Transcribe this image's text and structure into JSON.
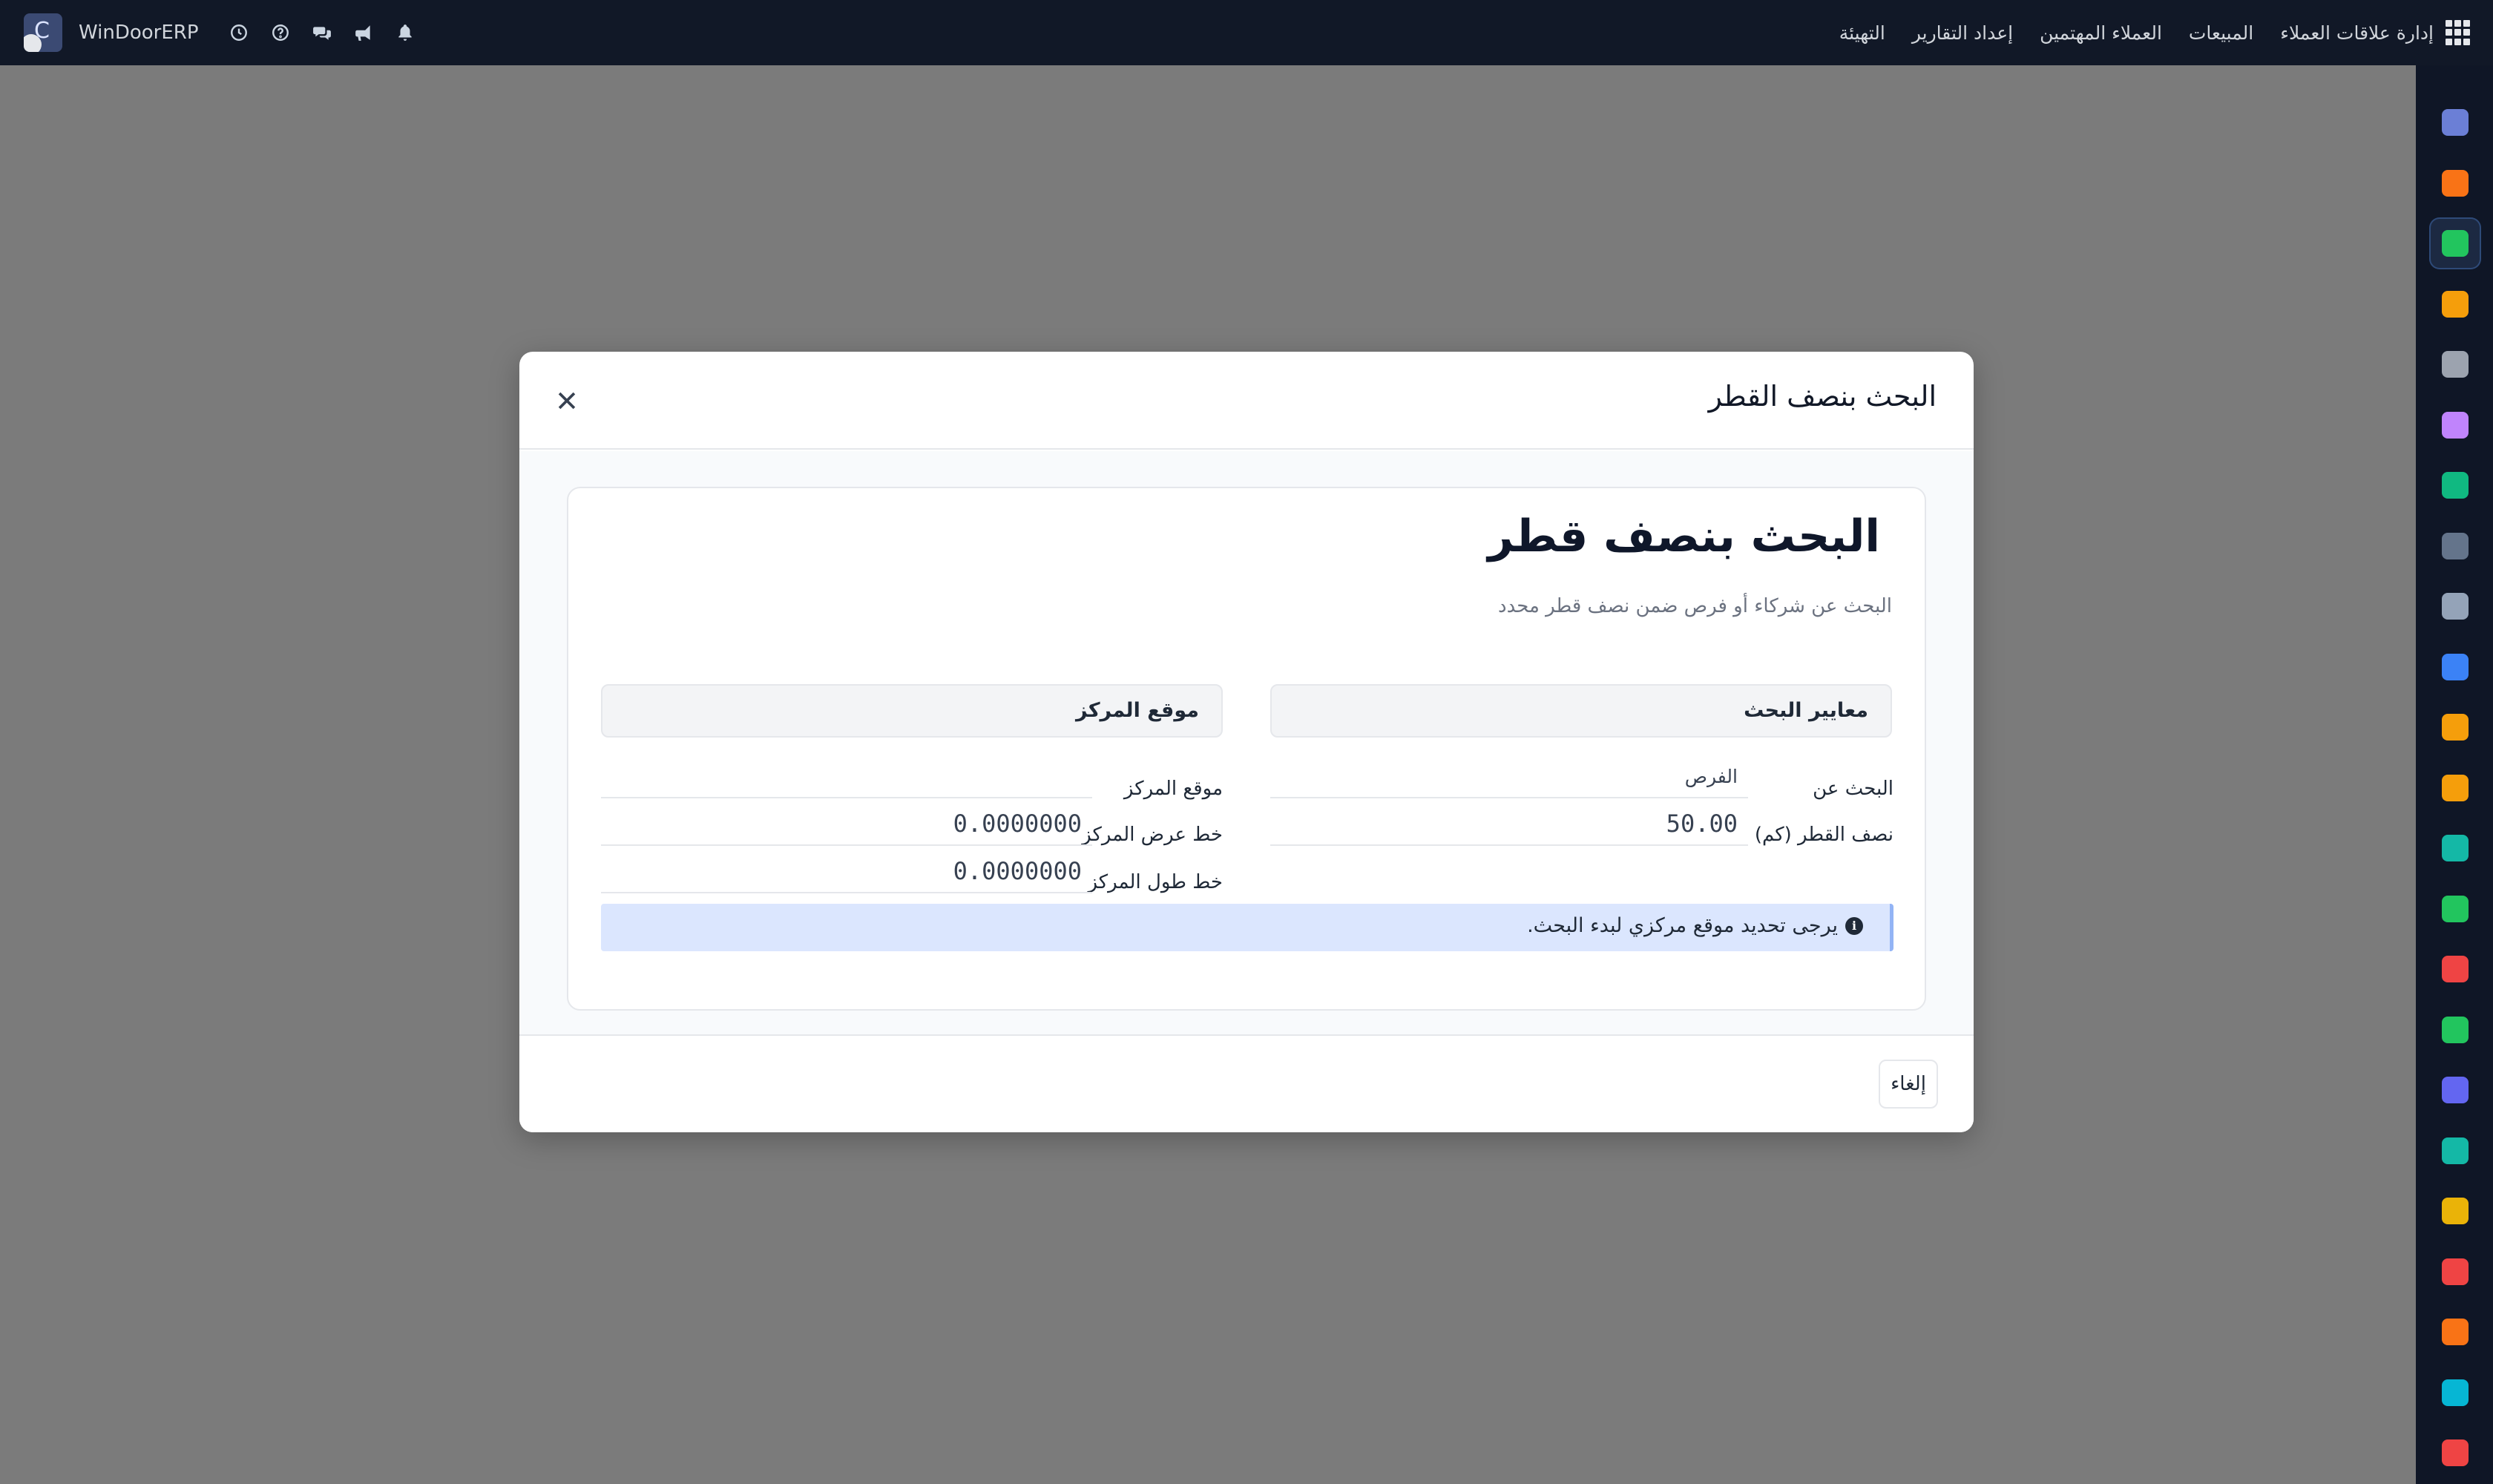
{
  "navbar": {
    "brand_name": "WinDoorERP",
    "menu": [
      "إدارة علاقات العملاء",
      "المبيعات",
      "العملاء المهتمين",
      "إعداد التقارير",
      "التهيئة"
    ],
    "icons": [
      "clock-icon",
      "help-icon",
      "chat-icon",
      "megaphone-icon",
      "bell-icon",
      "apps-grid-icon"
    ]
  },
  "appbar": {
    "items": [
      {
        "icon": "mail-app-icon",
        "color": "#6b7fd6"
      },
      {
        "icon": "discuss-app-icon",
        "color": "#f97316"
      },
      {
        "icon": "crm-app-icon",
        "color": "#22c55e"
      },
      {
        "icon": "sales-app-icon",
        "color": "#f59e0b"
      },
      {
        "icon": "product-app-icon",
        "color": "#9ca3af"
      },
      {
        "icon": "contacts-app-icon",
        "color": "#c084fc"
      },
      {
        "icon": "tasks-app-icon",
        "color": "#10b981"
      },
      {
        "icon": "helpdesk-app-icon",
        "color": "#64748b"
      },
      {
        "icon": "inventory-app-icon",
        "color": "#94a3b8"
      },
      {
        "icon": "documents-app-icon",
        "color": "#3b82f6"
      },
      {
        "icon": "employees-app-icon",
        "color": "#f59e0b"
      },
      {
        "icon": "calendar-app-icon",
        "color": "#f59e0b"
      },
      {
        "icon": "sign-app-icon",
        "color": "#14b8a6"
      },
      {
        "icon": "hr-app-icon",
        "color": "#22c55e"
      },
      {
        "icon": "dashboard-app-icon",
        "color": "#ef4444"
      },
      {
        "icon": "whatsapp-app-icon",
        "color": "#22c55e"
      },
      {
        "icon": "timer-app-icon",
        "color": "#6366f1"
      },
      {
        "icon": "website-app-icon",
        "color": "#14b8a6"
      },
      {
        "icon": "telegram-app-icon",
        "color": "#eab308"
      },
      {
        "icon": "spreadsheet-app-icon",
        "color": "#ef4444"
      },
      {
        "icon": "modules-app-icon",
        "color": "#f97316"
      },
      {
        "icon": "analytics-app-icon",
        "color": "#06b6d4"
      },
      {
        "icon": "settings-app-icon",
        "color": "#ef4444"
      }
    ],
    "active_index": 2
  },
  "modal": {
    "title": "البحث بنصف القطر",
    "close_icon": "close-icon",
    "cancel_label": "إلغاء"
  },
  "form": {
    "title": "البحث بنصف قطر",
    "subtitle": "البحث عن شركاء أو فرص ضمن نصف قطر محدد",
    "criteria_section": "معايير البحث",
    "center_section": "موقع المركز",
    "search_for_label": "البحث عن",
    "search_for_value": "الفرص",
    "radius_label": "نصف القطر (كم)",
    "radius_value": "50.00",
    "center_location_label": "موقع المركز",
    "center_location_value": "",
    "center_lat_label": "خط عرض المركز",
    "center_lat_value": "0.0000000",
    "center_lng_label": "خط طول المركز",
    "center_lng_value": "0.0000000",
    "alert_text": "يرجى تحديد موقع مركزي لبدء البحث.",
    "alert_icon": "info-icon"
  }
}
